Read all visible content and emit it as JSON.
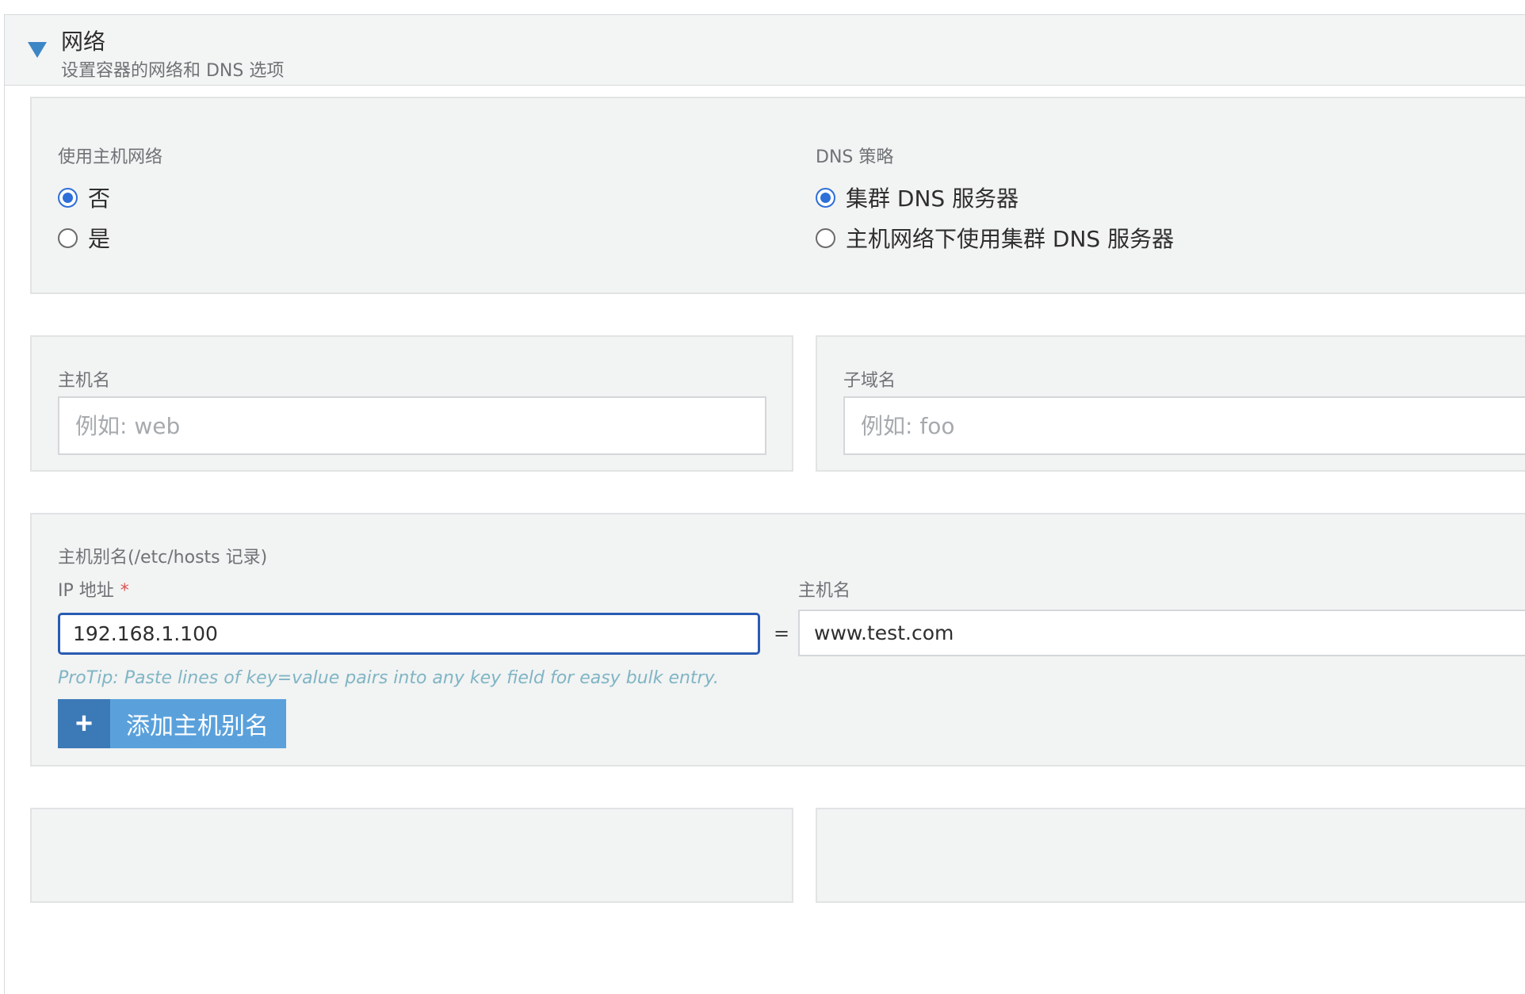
{
  "section": {
    "title": "网络",
    "subtitle": "设置容器的网络和 DNS 选项"
  },
  "host_network": {
    "label": "使用主机网络",
    "options": [
      {
        "label": "否",
        "selected": true
      },
      {
        "label": "是",
        "selected": false
      }
    ]
  },
  "dns_policy": {
    "label": "DNS 策略",
    "options": [
      {
        "label": "集群 DNS 服务器",
        "selected": true
      },
      {
        "label": "主机网络下使用集群 DNS 服务器",
        "selected": false
      }
    ]
  },
  "hostname": {
    "label": "主机名",
    "placeholder": "例如: web",
    "value": ""
  },
  "subdomain": {
    "label": "子域名",
    "placeholder": "例如: foo",
    "value": ""
  },
  "host_aliases": {
    "label": "主机别名(/etc/hosts 记录)",
    "ip_label": "IP 地址",
    "ip_required_marker": "*",
    "hostname_label": "主机名",
    "entries": [
      {
        "ip": "192.168.1.100",
        "hostname": "www.test.com"
      }
    ],
    "separator": "=",
    "protip": "ProTip: Paste lines of key=value pairs into any key field for easy bulk entry.",
    "add_button_icon": "plus-icon",
    "add_button_label": "添加主机别名"
  },
  "colors": {
    "accent": "#3d86c6",
    "radio_selected": "#2d6fd8",
    "button": "#5aa1dc",
    "button_icon_bg": "#3c79b7",
    "focused_border": "#2a5bb1",
    "required": "#d9534f",
    "protip": "#7fb5c4"
  }
}
